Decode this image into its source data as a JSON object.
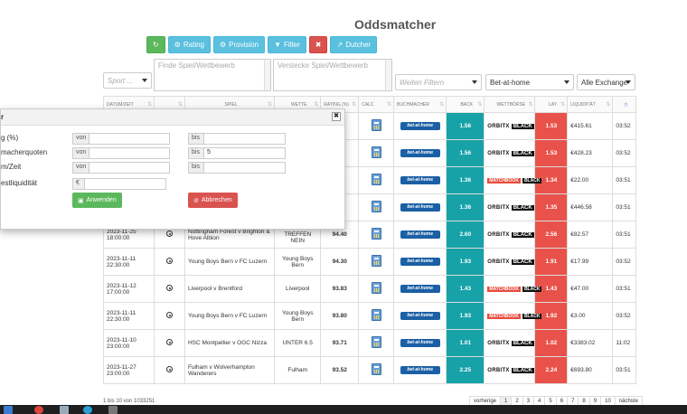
{
  "title": "Oddsmatcher",
  "toolbar": {
    "refresh_icon": "refresh-icon",
    "rating": "Rating",
    "provision": "Provision",
    "filter": "Filter",
    "clear_icon": "x-icon",
    "dutcher": "Dutcher"
  },
  "filters": {
    "sport_placeholder": "Sport ...",
    "find_placeholder": "Finde Spiel/Wettbewerb",
    "hide_placeholder": "Verstecke Spiel/Wettbewerb",
    "more_placeholder": "Weiten Filtern",
    "bookmaker": "Bet-at-home",
    "exchange": "Alle Exchange"
  },
  "columns": [
    "DATUM/ZEIT",
    "",
    "SPIEL",
    "WETTE",
    "RATING (%)",
    "CALC",
    "BUCHMACHER",
    "BACK",
    "WETTBÖRSE",
    "LAY",
    "LIQUIDITÄT",
    ""
  ],
  "rows": [
    {
      "date": "",
      "time": "",
      "game": "",
      "bet": "",
      "rating": "",
      "back": "1.56",
      "exchange": "orbitx",
      "lay": "1.53",
      "liq": "€415.61",
      "upd": "03:52"
    },
    {
      "date": "",
      "time": "",
      "game": "",
      "bet": "",
      "rating": "",
      "back": "1.56",
      "exchange": "orbitx",
      "lay": "1.53",
      "liq": "€428.23",
      "upd": "03:52"
    },
    {
      "date": "",
      "time": "",
      "game": "",
      "bet": "",
      "rating": "",
      "back": "1.36",
      "exchange": "matchbook",
      "lay": "1.34",
      "liq": "€22.00",
      "upd": "03:51"
    },
    {
      "date": "",
      "time": "",
      "game": "",
      "bet": "",
      "rating": "",
      "back": "1.36",
      "exchange": "orbitx",
      "lay": "1.35",
      "liq": "€446.58",
      "upd": "03:51"
    },
    {
      "date": "2023-11-25",
      "time": "18:00:00",
      "game": "Nottingham Forest v Brighton & Hove Albion",
      "bet": "BEIDE TREFFEN NEIN",
      "rating": "94.40",
      "back": "2.60",
      "exchange": "orbitx",
      "lay": "2.56",
      "liq": "€82.57",
      "upd": "03:51"
    },
    {
      "date": "2023-11-11",
      "time": "22:30:00",
      "game": "Young Boys Bern v FC Luzern",
      "bet": "Young Boys Bern",
      "rating": "94.30",
      "back": "1.93",
      "exchange": "orbitx",
      "lay": "1.91",
      "liq": "€17.99",
      "upd": "03:52"
    },
    {
      "date": "2023-11-12",
      "time": "17:00:00",
      "game": "Liverpool v Brentford",
      "bet": "Liverpool",
      "rating": "93.83",
      "back": "1.43",
      "exchange": "matchbook",
      "lay": "1.43",
      "liq": "€47.00",
      "upd": "03:51"
    },
    {
      "date": "2023-11-11",
      "time": "22:30:00",
      "game": "Young Boys Bern v FC Luzern",
      "bet": "Young Boys Bern",
      "rating": "93.80",
      "back": "1.93",
      "exchange": "matchbook",
      "lay": "1.92",
      "liq": "€3.00",
      "upd": "03:52"
    },
    {
      "date": "2023-11-10",
      "time": "23:00:00",
      "game": "HSC Montpellier v OGC Nizza",
      "bet": "UNTER 6.5",
      "rating": "93.71",
      "back": "1.01",
      "exchange": "orbitx",
      "lay": "1.02",
      "liq": "€3383.02",
      "upd": "11:02"
    },
    {
      "date": "2023-11-27",
      "time": "23:00:00",
      "game": "Fulham v Wolverhampton Wanderers",
      "bet": "Fulham",
      "rating": "93.52",
      "back": "2.25",
      "exchange": "orbitx",
      "lay": "2.24",
      "liq": "€693.80",
      "upd": "03:51"
    }
  ],
  "bookmaker_logo": "bet-at-home",
  "orbitx_text": "ORBITX",
  "black_text": "BLACK",
  "matchbook_text": "MATCHBOOK",
  "footer": "1 bis 10 von 1033251",
  "pager": {
    "prev": "vorherige",
    "pages": [
      "1",
      "2",
      "3",
      "4",
      "5",
      "6",
      "7",
      "8",
      "9",
      "10"
    ],
    "next": "nächste"
  },
  "modal": {
    "title": "r",
    "rows": [
      {
        "label": "g (%)",
        "from_addon": "von",
        "from": "",
        "to_addon": "bis",
        "to": ""
      },
      {
        "label": "macherquoten",
        "from_addon": "von",
        "from": "",
        "to_addon": "bis",
        "to": "5"
      },
      {
        "label": "m/Zeit",
        "from_addon": "von",
        "from": "",
        "to_addon": "bis",
        "to": ""
      }
    ],
    "liq_label": "estliquidität",
    "liq_addon": "€",
    "apply": "Anwenden",
    "cancel": "Abbrechen"
  },
  "colors": {
    "back": "#17a2a8",
    "lay": "#e8524a",
    "green": "#5cb85c",
    "cyan": "#5bc0de",
    "red": "#d9534f"
  }
}
